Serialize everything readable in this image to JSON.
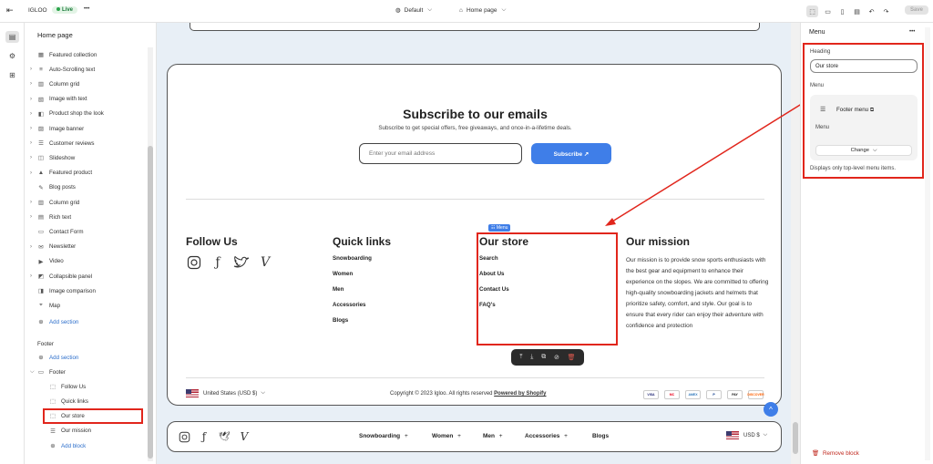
{
  "topbar": {
    "store_name": "IGLOO",
    "live_label": "Live",
    "more": "•••",
    "theme_label": "Default",
    "page_label": "Home page",
    "save_label": "Save"
  },
  "sidebar": {
    "title": "Home page",
    "sections": [
      {
        "label": "Featured collection",
        "icon": "collection-icon",
        "chevron": false
      },
      {
        "label": "Auto-Scrolling text",
        "icon": "text-icon",
        "chevron": true
      },
      {
        "label": "Column grid",
        "icon": "grid-icon",
        "chevron": true
      },
      {
        "label": "Image with text",
        "icon": "image-text-icon",
        "chevron": true
      },
      {
        "label": "Product shop the look",
        "icon": "product-icon",
        "chevron": true
      },
      {
        "label": "Image banner",
        "icon": "banner-icon",
        "chevron": true
      },
      {
        "label": "Customer reviews",
        "icon": "reviews-icon",
        "chevron": true
      },
      {
        "label": "Slideshow",
        "icon": "slideshow-icon",
        "chevron": true
      },
      {
        "label": "Featured product",
        "icon": "tag-icon",
        "chevron": true
      },
      {
        "label": "Blog posts",
        "icon": "blog-icon",
        "chevron": false
      },
      {
        "label": "Column grid",
        "icon": "grid-icon",
        "chevron": true
      },
      {
        "label": "Rich text",
        "icon": "richtext-icon",
        "chevron": true
      },
      {
        "label": "Contact Form",
        "icon": "form-icon",
        "chevron": false
      },
      {
        "label": "Newsletter",
        "icon": "mail-icon",
        "chevron": true
      },
      {
        "label": "Video",
        "icon": "video-icon",
        "chevron": false
      },
      {
        "label": "Collapsible panel",
        "icon": "panel-icon",
        "chevron": true
      },
      {
        "label": "Image comparison",
        "icon": "compare-icon",
        "chevron": false
      },
      {
        "label": "Map",
        "icon": "map-icon",
        "chevron": false
      }
    ],
    "add_section": "Add section",
    "footer_label": "Footer",
    "footer_add_section": "Add section",
    "footer_group": "Footer",
    "footer_blocks": [
      "Follow Us",
      "Quick links",
      "Our store",
      "Our mission"
    ],
    "add_block": "Add block"
  },
  "store": {
    "subscribe_heading": "Subscribe to our emails",
    "subscribe_text": "Subscribe to get special offers, free giveaways, and once-in-a-lifetime deals.",
    "email_placeholder": "Enter your email address",
    "subscribe_button": "Subscribe ↗",
    "menu_tag": "Menu",
    "follow_heading": "Follow Us",
    "quick_heading": "Quick links",
    "quick_links": [
      "Snowboarding",
      "Women",
      "Men",
      "Accessories",
      "Blogs"
    ],
    "store_heading": "Our store",
    "store_links": [
      "Search",
      "About Us",
      "Contact Us",
      "FAQ's"
    ],
    "mission_heading": "Our mission",
    "mission_text": "Our mission is to provide snow sports enthusiasts with the best gear and equipment to enhance their experience on the slopes. We are committed to offering high-quality snowboarding jackets and helmets that prioritize safety, comfort, and style. Our goal is to ensure that every rider can enjoy their adventure with confidence and protection",
    "country": "United States (USD $)",
    "copyright": "© 2023 Igloo. All rights reserved",
    "copyright_pre": "Copyright",
    "powered": "Powered by Shopify",
    "payments": [
      "VISA",
      "MC",
      "AMEX",
      "P",
      "PAY",
      "DISCOVER"
    ],
    "footer_links": [
      "Snowboarding",
      "Women",
      "Men",
      "Accessories",
      "Blogs"
    ],
    "currency": "USD $"
  },
  "panel": {
    "title": "Menu",
    "more": "•••",
    "heading_label": "Heading",
    "heading_value": "Our store",
    "menu_label": "Menu",
    "menu_name": "Footer menu",
    "menu_sub": "Menu",
    "change": "Change",
    "hint": "Displays only top-level menu items.",
    "remove": "Remove block"
  }
}
